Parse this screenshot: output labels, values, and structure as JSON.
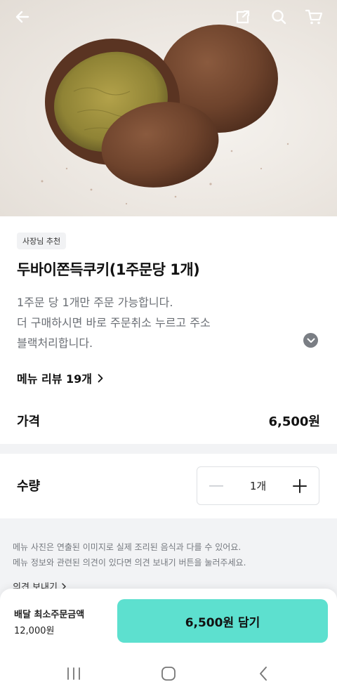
{
  "header": {
    "icons": [
      "back-arrow-icon",
      "share-icon",
      "search-icon",
      "cart-icon"
    ]
  },
  "product": {
    "badge": "사장님 추천",
    "title": "두바이쫀득쿠키(1주문당 1개)",
    "description_lines": [
      "1주문 당 1개만 주문 가능합니다.",
      "더 구매하시면 바로 주문취소 누르고 주소",
      "블랙처리합니다."
    ],
    "review_link": "메뉴 리뷰 19개",
    "price_label": "가격",
    "price_value": "6,500원"
  },
  "quantity": {
    "label": "수량",
    "value": "1개"
  },
  "notice": {
    "lines": [
      "메뉴 사진은 연출된 이미지로 실제 조리된 음식과 다를 수 있어요.",
      "메뉴 정보와 관련된 의견이 있다면 의견 보내기 버튼을 눌러주세요."
    ],
    "feedback_link": "의견 보내기"
  },
  "bottom_bar": {
    "min_order_label": "배달 최소주문금액",
    "min_order_value": "12,000원",
    "cart_button": "6,500원 담기"
  },
  "colors": {
    "accent": "#5de0cf",
    "muted_text": "#6b6f75",
    "section_bg": "#f2f3f5"
  }
}
